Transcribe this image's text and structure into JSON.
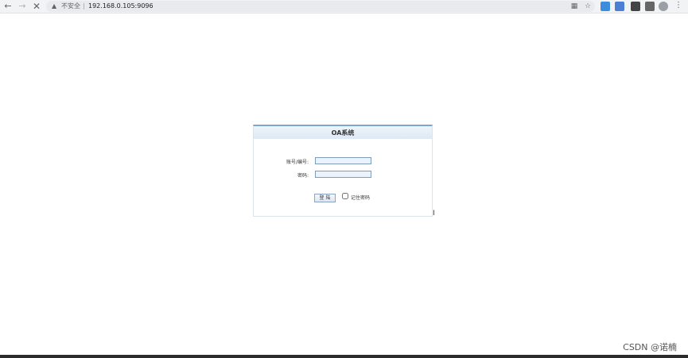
{
  "browser": {
    "back_icon": "arrow-left-icon",
    "forward_icon": "arrow-right-icon",
    "stop_icon": "close-icon",
    "security_label": "不安全",
    "url": "192.168.0.105:9096"
  },
  "login": {
    "title": "OA系统",
    "account_label": "账号/编号:",
    "account_value": "",
    "password_label": "密码:",
    "password_value": "",
    "submit_label": "登 陆",
    "remember_label": "记住密码",
    "remember_checked": false
  },
  "watermark": {
    "text": "CSDN @诺楠"
  },
  "colors": {
    "panel_border_top": "#7fa6cf",
    "input_background": "#eaf2fb",
    "input_border": "#7f9db9"
  }
}
